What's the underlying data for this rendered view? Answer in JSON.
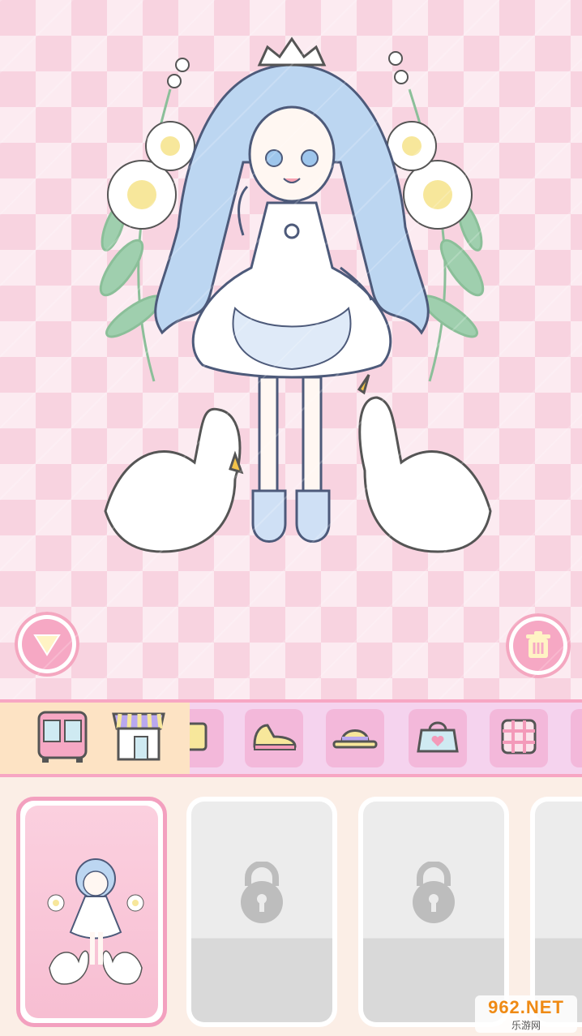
{
  "scene": {
    "background": "pink-argyle",
    "character": "swan-princess-doll",
    "colors": {
      "pink": "#f8d3e0",
      "accent": "#f6a8c4",
      "hair": "#b9d3f0",
      "dress": "#ffffff"
    }
  },
  "controls": {
    "collapse_icon": "triangle-down-icon",
    "trash_icon": "trash-icon"
  },
  "toolbar": {
    "left_icons": [
      "wardrobe-icon",
      "shop-icon"
    ],
    "categories": [
      "top-icon",
      "shoes-icon",
      "hat-icon",
      "bag-icon",
      "pattern-icon"
    ]
  },
  "slots": {
    "total_visible": 4,
    "unlocked": 1,
    "lock_icon": "padlock-icon"
  },
  "watermark": {
    "brand": "962.NET",
    "subtitle": "乐游网"
  }
}
